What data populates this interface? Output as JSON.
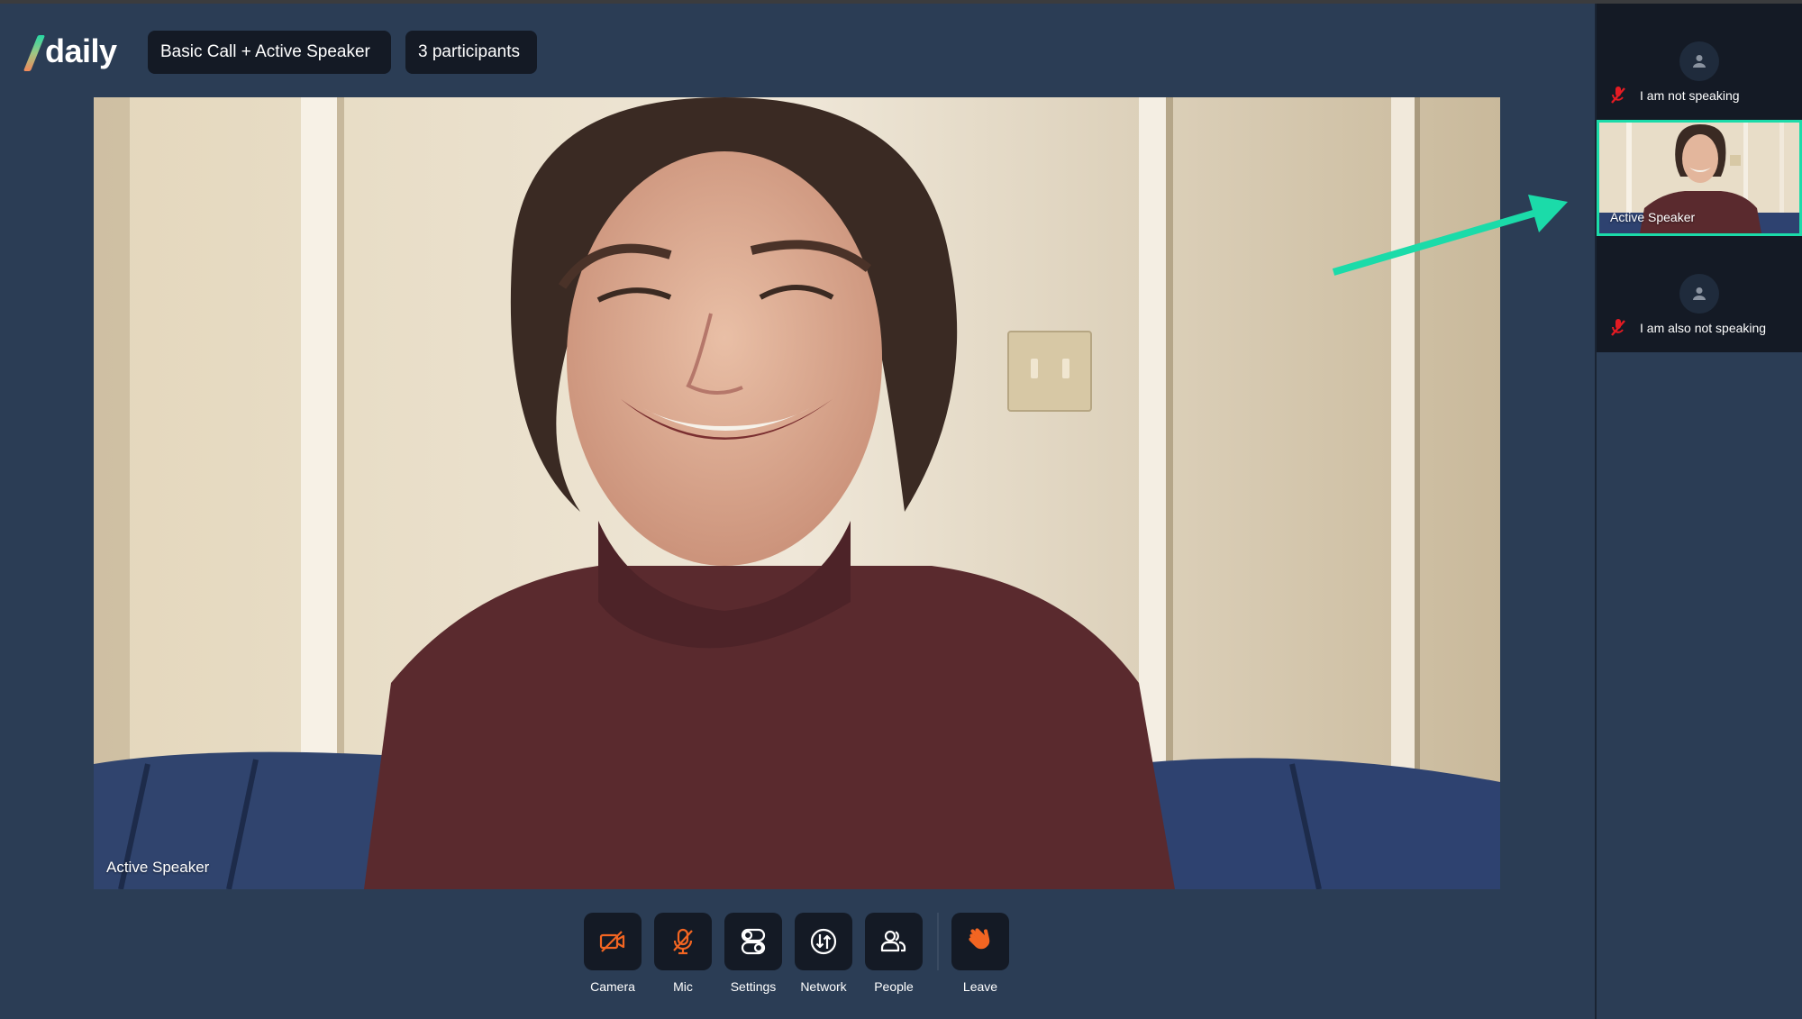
{
  "app": {
    "logo_text": "daily",
    "call_title": "Basic Call + Active Speaker",
    "participant_count": "3 participants"
  },
  "main_video": {
    "label": "Active Speaker"
  },
  "controls": [
    {
      "id": "camera",
      "label": "Camera",
      "icon": "camera-off-icon",
      "state": "off"
    },
    {
      "id": "mic",
      "label": "Mic",
      "icon": "mic-off-icon",
      "state": "off"
    },
    {
      "id": "settings",
      "label": "Settings",
      "icon": "settings-toggles-icon"
    },
    {
      "id": "network",
      "label": "Network",
      "icon": "network-icon"
    },
    {
      "id": "people",
      "label": "People",
      "icon": "people-icon"
    },
    {
      "id": "leave",
      "label": "Leave",
      "icon": "waving-hand-icon"
    }
  ],
  "participants": [
    {
      "name": "I am not speaking",
      "video": false,
      "muted": true,
      "active": false
    },
    {
      "name": "Active Speaker",
      "video": true,
      "muted": false,
      "active": true
    },
    {
      "name": "I am also not speaking",
      "video": false,
      "muted": true,
      "active": false
    }
  ],
  "colors": {
    "background": "#2b3d55",
    "surface": "#141a25",
    "accent_teal": "#1bdba9",
    "control_orange": "#f26522",
    "muted_red": "#e41b23"
  }
}
